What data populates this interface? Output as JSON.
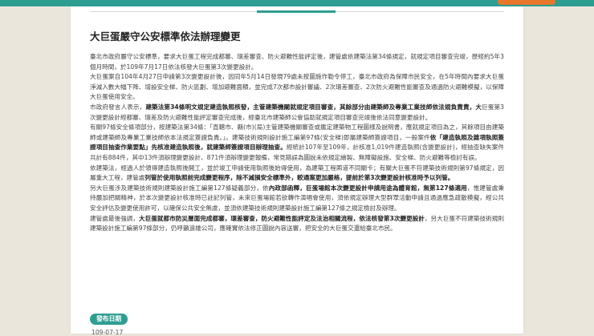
{
  "title": "大巨蛋嚴守公安標準依法辦理變更",
  "paragraphs": [
    [
      {
        "t": "臺北市政府嚴守公安標準，要求大巨蛋工程完成都審、環差審查、防火避難性能評定後，建管處依建築法第34條規定，就規定項目審查完竣，歷經約5年3個月時間，於109年7月17日依法核發大巨蛋第3次變更設計。"
      }
    ],
    [
      {
        "t": "大巨蛋案自104年4月27日申請第3次變更設計後，因同年5月14日發現79處未按圖施作勒令停工，臺北市政府為保障市民安全，在5年時間內要求大巨蛋淨減入數大幅下降、增設安全梯、防火區劃、增加避難面積，並完成7次都市設計審議、2次環差審查、2次防火避難性能審查及通過防火避難模擬，以保障大巨蛋使用安全。"
      }
    ],
    [
      {
        "t": "市政府發言人表示，"
      },
      {
        "t": "建築法第34條明文規定建造執照核發，主管建築機關就規定項目審查，其餘部分由建築師及專業工業技師依法規負責責，大",
        "b": true
      },
      {
        "t": "巨蛋第3次變更設計經都審、環差及防火避難性能評定審查完成後，經臺北市建築師公會協助就規定項目審查完竣後依法同意變更設計。"
      }
    ],
    [
      {
        "t": "有關97條安全條項部分，按建築法第34條：「直轄市、縣(市)(局)主管建築機關審查或鑑定建築物工程圖樣及說明書，應就規定項目為之，其餘項目由建築師或建築師及專業工業技師依本法規定簽證負責。」。建築技術規則設計施工編第97條(安全梯)即屬建築師簽證項目，一般案件"
      },
      {
        "t": "依「建造執照及雜項執照簽證項目抽查作業要點」先核准建造執照後，就建築師簽證項目辦理抽查。",
        "b": true
      },
      {
        "t": "經統計107年至109年，計核准1,019件建造執照(含變更設計)，經抽查缺失案件共計有884件，其中13件須辦理變更設計、871件須辦理變更報備，常見錯誤為圖說未依規定繪製、無障礙設施、安全梯、防火避難等檢討有誤。"
      }
    ],
    [
      {
        "t": "依建築法，經過人於領得建造執照後開工，並於竣工申請使用執照後始得使用，為建築工程兩道不同關卡；有關大巨蛋不符建築技術規則第97條規定，因屬重大工程，建管處"
      },
      {
        "t": "列管於使用執照前完成變更程序，除不減損安全標準外，較通案更加嚴格，提前於第3次變更設計核准時予以列管。",
        "b": true
      }
    ],
    [
      {
        "t": "另大巨蛋涉及建築技術規則建築設計施工編第127條疑義部分，依"
      },
      {
        "t": "內政部函釋，巨蛋場館本次變更設計申請用途為體育館，無第127條適用",
        "b": true
      },
      {
        "t": "，惟建管處秉持嚴加把關精神，於本次變更設計核准時已註記列管，未來巨蛋場館若欲轉作演唱會使用，須依規定辦理大型群眾活動申請且通過應急疏散模擬，經公共安全評估及變更使用許可，以確保公共安全無虞，並須依建築技術規則建築設計施工編第127條之規定檢討及辦理。"
      }
    ],
    [
      {
        "t": "建管處最後強調，"
      },
      {
        "t": "大巨蛋就都市防災層面完成都審，環差審查，防火避難性能評定及法治相關流程，依法核發第3次變更設計",
        "b": true
      },
      {
        "t": "，另大巨蛋不符建築技術規則建築設計施工編第97條部分，仍呼籲遠雄公司，應確實依法修正圖說內容送審，把安全的大巨蛋交還給臺北市民。"
      }
    ]
  ],
  "badge_label": "發布日期",
  "publish_date": "109-07-17",
  "colors": {
    "brand": "#2e9e92",
    "accent": "#e8762b",
    "background": "#ebe6dc"
  }
}
